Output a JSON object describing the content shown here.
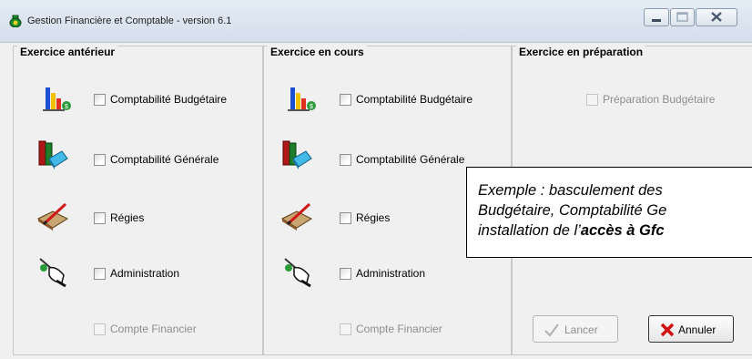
{
  "window": {
    "title": "Gestion Financière et Comptable - version 6.1",
    "icons": [
      "money-bag-icon",
      "minimize-icon",
      "maximize-icon",
      "close-icon"
    ]
  },
  "panels": {
    "anterieur": {
      "title": "Exercice antérieur",
      "items": [
        {
          "label": "Comptabilité Budgétaire",
          "icon": "budget-chart-icon"
        },
        {
          "label": "Comptabilité Générale",
          "icon": "books-icon"
        },
        {
          "label": "Régies",
          "icon": "pen-notebook-icon"
        },
        {
          "label": "Administration",
          "icon": "admin-hand-icon"
        }
      ],
      "compte_financier": "Compte Financier"
    },
    "en_cours": {
      "title": "Exercice en cours",
      "items": [
        {
          "label": "Comptabilité Budgétaire",
          "icon": "budget-chart-icon"
        },
        {
          "label": "Comptabilité Générale",
          "icon": "books-icon"
        },
        {
          "label": "Régies",
          "icon": "pen-notebook-icon"
        },
        {
          "label": "Administration",
          "icon": "admin-hand-icon"
        }
      ],
      "compte_financier": "Compte Financier"
    },
    "preparation": {
      "title": "Exercice en préparation",
      "preparation_label": "Préparation Budgétaire"
    }
  },
  "buttons": {
    "lancer": "Lancer",
    "annuler": "Annuler"
  },
  "callout": {
    "line1": "Exemple : basculement des",
    "line2": "Budgétaire, Comptabilité Ge",
    "line3_prefix": "installation de l’",
    "line3_bold": "accès à Gfc"
  },
  "colors": {
    "window_bg": "#f0f0f0",
    "disabled_text": "#8d8d8d",
    "cancel_red": "#d01010"
  }
}
